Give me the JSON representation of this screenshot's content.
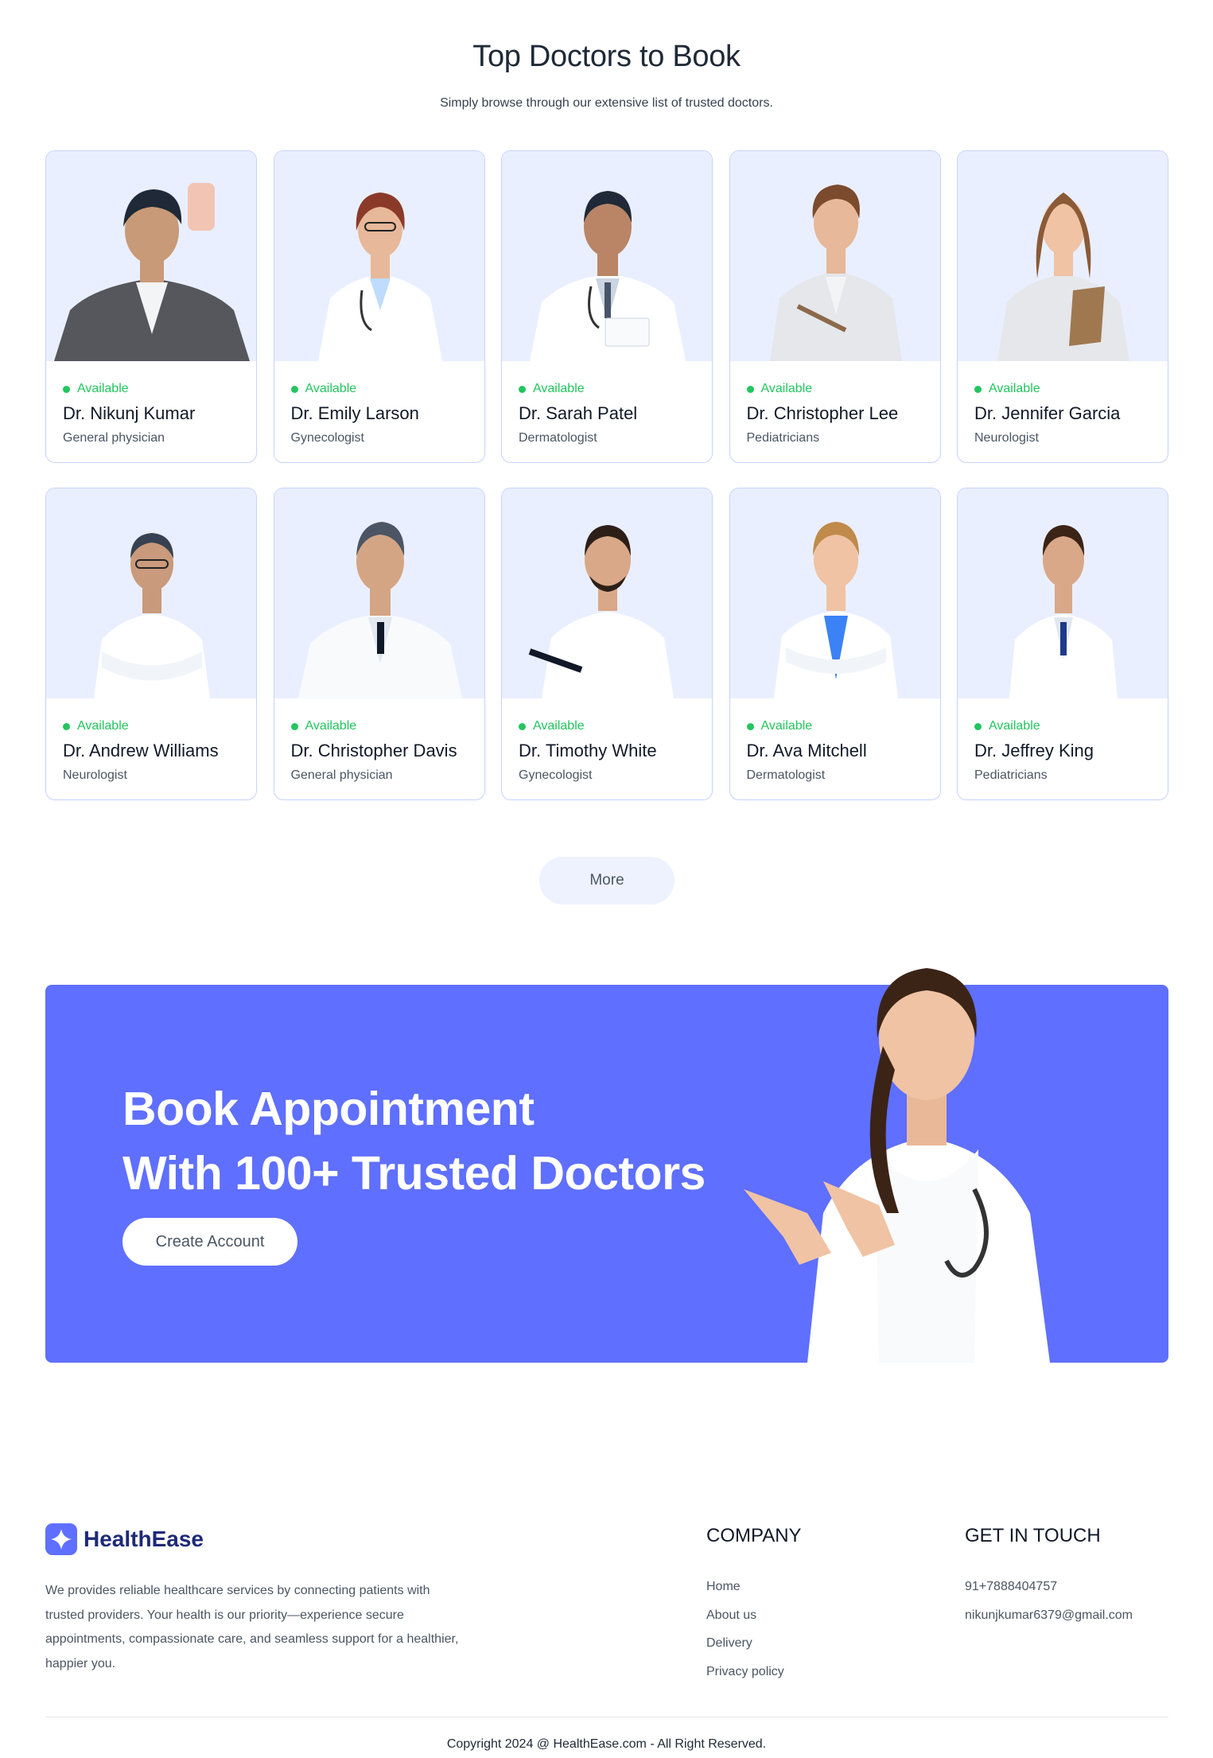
{
  "section": {
    "title": "Top Doctors to Book",
    "subtitle": "Simply browse through our extensive list of trusted doctors."
  },
  "doctors": [
    {
      "status": "Available",
      "name": "Dr. Nikunj Kumar",
      "speciality": "General physician"
    },
    {
      "status": "Available",
      "name": "Dr. Emily Larson",
      "speciality": "Gynecologist"
    },
    {
      "status": "Available",
      "name": "Dr. Sarah Patel",
      "speciality": "Dermatologist"
    },
    {
      "status": "Available",
      "name": "Dr. Christopher Lee",
      "speciality": "Pediatricians"
    },
    {
      "status": "Available",
      "name": "Dr. Jennifer Garcia",
      "speciality": "Neurologist"
    },
    {
      "status": "Available",
      "name": "Dr. Andrew Williams",
      "speciality": "Neurologist"
    },
    {
      "status": "Available",
      "name": "Dr. Christopher Davis",
      "speciality": "General physician"
    },
    {
      "status": "Available",
      "name": "Dr. Timothy White",
      "speciality": "Gynecologist"
    },
    {
      "status": "Available",
      "name": "Dr. Ava Mitchell",
      "speciality": "Dermatologist"
    },
    {
      "status": "Available",
      "name": "Dr. Jeffrey King",
      "speciality": "Pediatricians"
    }
  ],
  "more_label": "More",
  "banner": {
    "line1": "Book Appointment",
    "line2": "With 100+ Trusted Doctors",
    "button_label": "Create Account"
  },
  "footer": {
    "brand": "HealthEase",
    "description": "We provides reliable healthcare services by connecting patients with trusted providers. Your health is our priority—experience secure appointments, compassionate care, and seamless support for a healthier, happier you.",
    "company_title": "COMPANY",
    "company_links": [
      "Home",
      "About us",
      "Delivery",
      "Privacy policy"
    ],
    "contact_title": "GET IN TOUCH",
    "phone": "91+7888404757",
    "email": "nikunjkumar6379@gmail.com",
    "copyright": "Copyright 2024 @ HealthEase.com - All Right Reserved."
  },
  "colors": {
    "accent": "#5f6fff",
    "available": "#22c55e",
    "card_photo_bg": "#eaefff",
    "brand_text": "#1e2a78"
  }
}
